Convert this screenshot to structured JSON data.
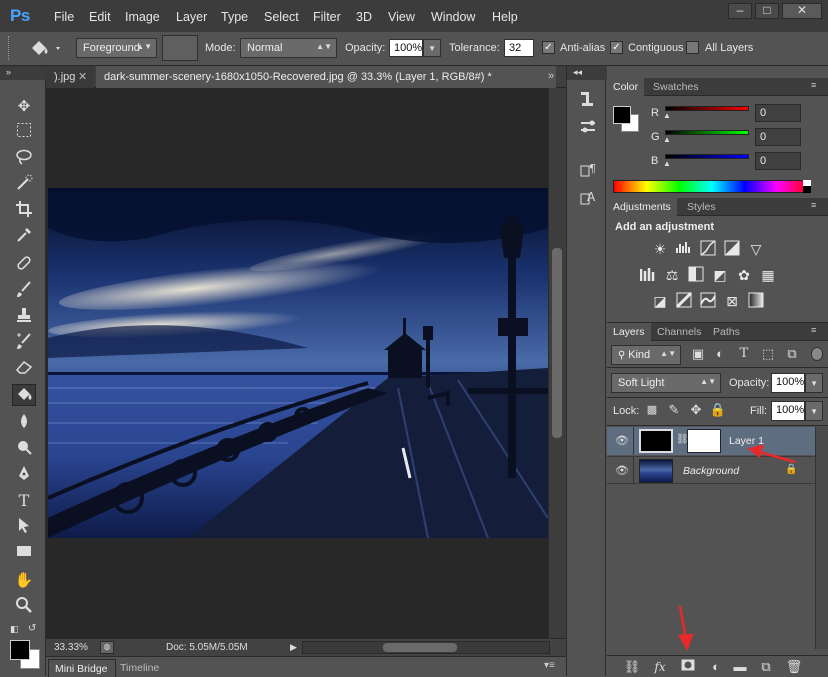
{
  "app": {
    "logo": "Ps"
  },
  "menu": [
    "File",
    "Edit",
    "Image",
    "Layer",
    "Type",
    "Select",
    "Filter",
    "3D",
    "View",
    "Window",
    "Help"
  ],
  "window_controls": {
    "minimize": "–",
    "maximize": "□",
    "close": "✕"
  },
  "options": {
    "fill_source": "Foreground",
    "mode_label": "Mode:",
    "mode_value": "Normal",
    "opacity_label": "Opacity:",
    "opacity_value": "100%",
    "tolerance_label": "Tolerance:",
    "tolerance_value": "32",
    "antialias_label": "Anti-alias",
    "contiguous_label": "Contiguous",
    "all_layers_label": "All Layers"
  },
  "tabs": {
    "prev": ").jpg",
    "active": "dark-summer-scenery-1680x1050-Recovered.jpg @ 33.3% (Layer 1, RGB/8#) *"
  },
  "status": {
    "zoom": "33.33%",
    "doc": "Doc: 5.05M/5.05M"
  },
  "bottom_tabs": [
    "Mini Bridge",
    "Timeline"
  ],
  "color_panel": {
    "tabs": [
      "Color",
      "Swatches"
    ],
    "r_label": "R",
    "r_value": "0",
    "g_label": "G",
    "g_value": "0",
    "b_label": "B",
    "b_value": "0"
  },
  "adjustments_panel": {
    "tabs": [
      "Adjustments",
      "Styles"
    ],
    "heading": "Add an adjustment"
  },
  "layers_panel": {
    "tabs": [
      "Layers",
      "Channels",
      "Paths"
    ],
    "kind_label": "Kind",
    "blend_mode": "Soft Light",
    "opacity_label": "Opacity:",
    "opacity_value": "100%",
    "lock_label": "Lock:",
    "fill_label": "Fill:",
    "fill_value": "100%",
    "layers": [
      {
        "name": "Layer 1",
        "selected": true
      },
      {
        "name": "Background",
        "selected": false
      }
    ]
  },
  "colors": {
    "foreground": "#000000",
    "background": "#ffffff",
    "accent_red": "#e8292b",
    "selected_layer": "#5f6d80"
  }
}
